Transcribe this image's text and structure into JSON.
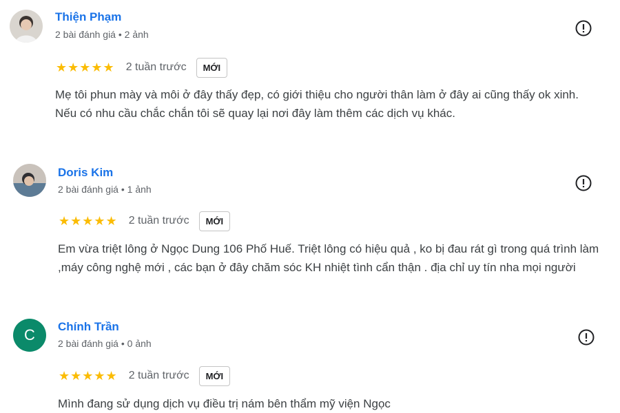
{
  "reviews": [
    {
      "name": "Thiện Phạm",
      "meta": "2 bài đánh giá • 2 ảnh",
      "avatar_letter": "",
      "stars": "★★★★★",
      "time": "2 tuần trước",
      "badge": "MỚI",
      "text_lines": [
        "Mẹ tôi phun mày và môi ở đây thấy đẹp, có giới thiệu cho người thân làm ở đây ai cũng thấy ok xinh.",
        "Nếu có nhu cầu chắc chắn tôi sẽ quay lại nơi đây làm thêm các dịch vụ khác."
      ]
    },
    {
      "name": "Doris Kim",
      "meta": "2 bài đánh giá • 1 ảnh",
      "avatar_letter": "",
      "stars": "★★★★★",
      "time": "2 tuần trước",
      "badge": "MỚI",
      "text_lines": [
        "Em vừa triệt lông ở Ngọc Dung 106 Phố Huế. Triệt lông có hiệu quả , ko bị đau rát gì trong quá trình làm ,máy công nghệ mới , các bạn ở đây chăm sóc KH nhiệt tình cẩn thận . địa chỉ uy tín nha mọi người"
      ]
    },
    {
      "name": "Chính Trần",
      "meta": "2 bài đánh giá • 0 ảnh",
      "avatar_letter": "C",
      "stars": "★★★★★",
      "time": "2 tuần trước",
      "badge": "MỚI",
      "text_lines": [
        "Mình đang sử dụng dịch vụ điều trị nám bên thẩm mỹ viện Ngọc"
      ]
    }
  ],
  "colors": {
    "name": "#1a73e8",
    "star": "#fbbc04",
    "avatar_letter_bg": "#0b8a6a"
  },
  "icons": {
    "flag": "report-icon"
  }
}
